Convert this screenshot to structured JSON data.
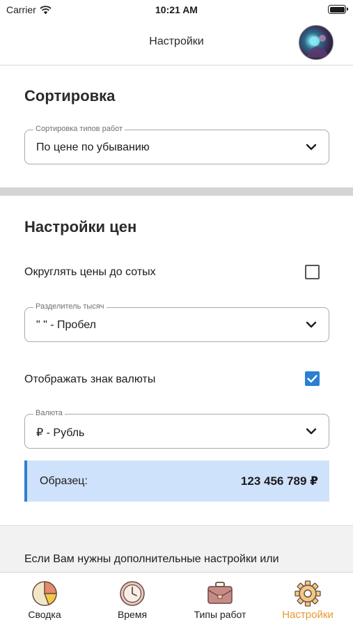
{
  "status_bar": {
    "carrier": "Carrier",
    "time": "10:21 AM"
  },
  "nav": {
    "title": "Настройки"
  },
  "sorting": {
    "title": "Сортировка",
    "select_label": "Сортировка типов работ",
    "select_value": "По цене по убыванию"
  },
  "price_settings": {
    "title": "Настройки цен",
    "round_label": "Округлять цены до сотых",
    "round_checked": false,
    "separator_label": "Разделитель тысяч",
    "separator_value": "\" \" - Пробел",
    "show_currency_label": "Отображать знак валюты",
    "show_currency_checked": true,
    "currency_label": "Валюта",
    "currency_value": "₽ - Рубль",
    "sample_label": "Образец:",
    "sample_value": "123 456 789 ₽"
  },
  "footer": {
    "text": "Если Вам нужны дополнительные настройки или"
  },
  "tabs": [
    {
      "label": "Сводка",
      "icon": "pie-chart-icon",
      "active": false
    },
    {
      "label": "Время",
      "icon": "clock-icon",
      "active": false
    },
    {
      "label": "Типы работ",
      "icon": "briefcase-icon",
      "active": false
    },
    {
      "label": "Настройки",
      "icon": "gear-icon",
      "active": true
    }
  ],
  "colors": {
    "accent": "#2b7fd4",
    "active_tab": "#e8982f",
    "sample_bg": "#cfe2fb"
  }
}
